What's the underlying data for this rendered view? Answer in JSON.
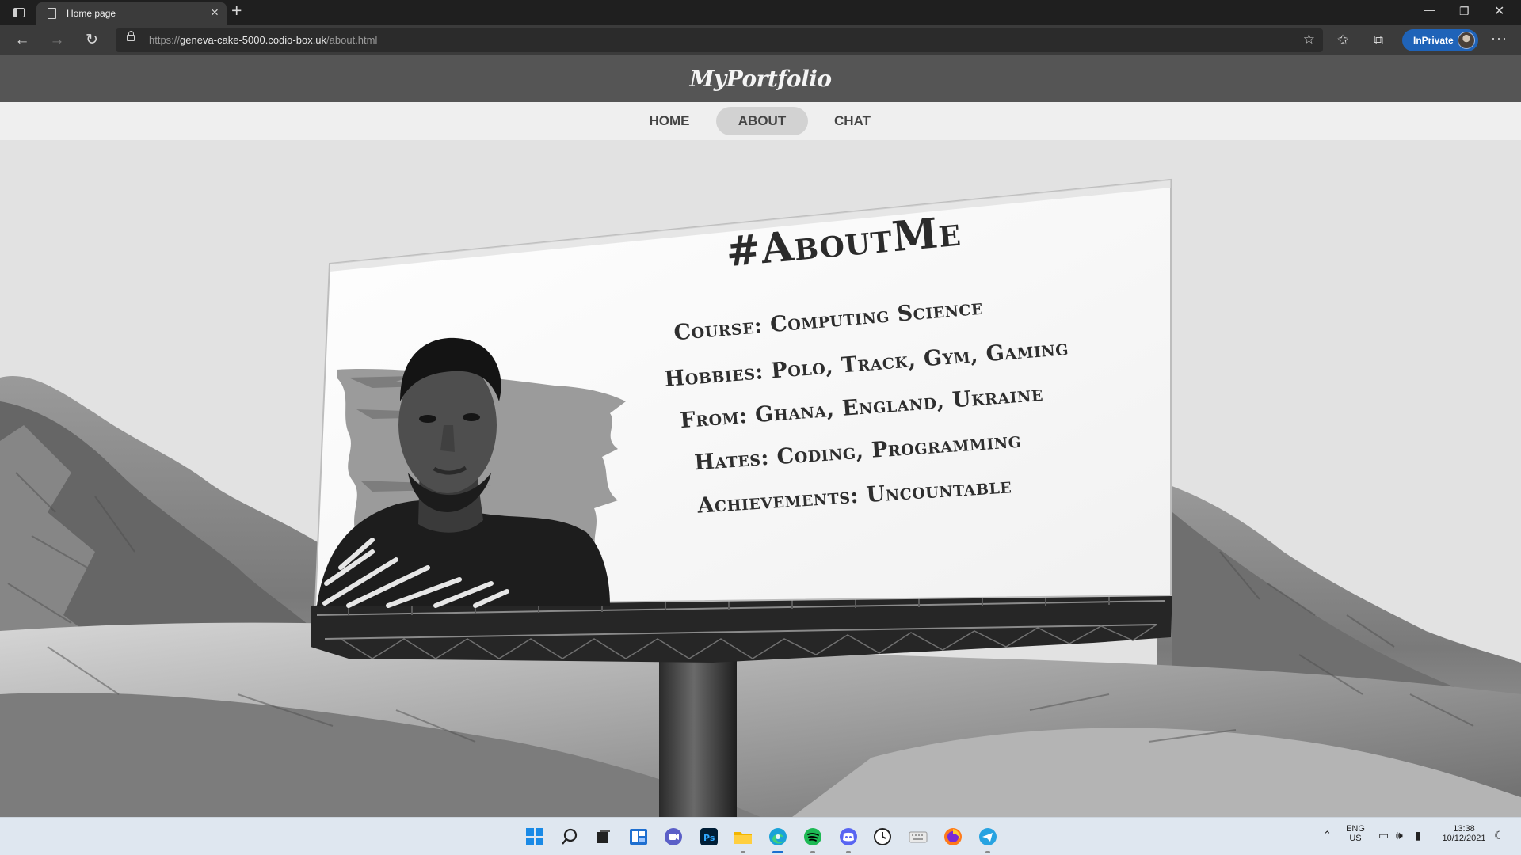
{
  "browser": {
    "tab_title": "Home page",
    "url_prefix": "https://",
    "url_host": "geneva-cake-5000.codio-box.uk",
    "url_path": "/about.html",
    "inprivate_label": "InPrivate"
  },
  "site": {
    "brand": "MyPortfolio",
    "nav": [
      {
        "label": "HOME"
      },
      {
        "label": "ABOUT",
        "active": true
      },
      {
        "label": "CHAT"
      }
    ]
  },
  "about": {
    "title": "#AboutMe",
    "lines": [
      "Course: Computing Science",
      "Hobbies: Polo, Track, Gym, Gaming",
      "From: Ghana, England, Ukraine",
      "Hates: Coding, Programming",
      "Achievements: Uncountable"
    ]
  },
  "taskbar": {
    "apps": [
      "windows-start",
      "search",
      "task-view",
      "widgets",
      "teams-chat",
      "photoshop",
      "file-explorer",
      "edge",
      "spotify",
      "discord",
      "clock",
      "keyboard",
      "firefox",
      "telegram"
    ],
    "lang_primary": "ENG",
    "lang_secondary": "US",
    "time": "13:38",
    "date": "10/12/2021"
  },
  "colors": {
    "edge_inprivate_blue": "#1f63b8",
    "site_header": "#555555",
    "nav_active_pill": "#d2d2d2"
  }
}
